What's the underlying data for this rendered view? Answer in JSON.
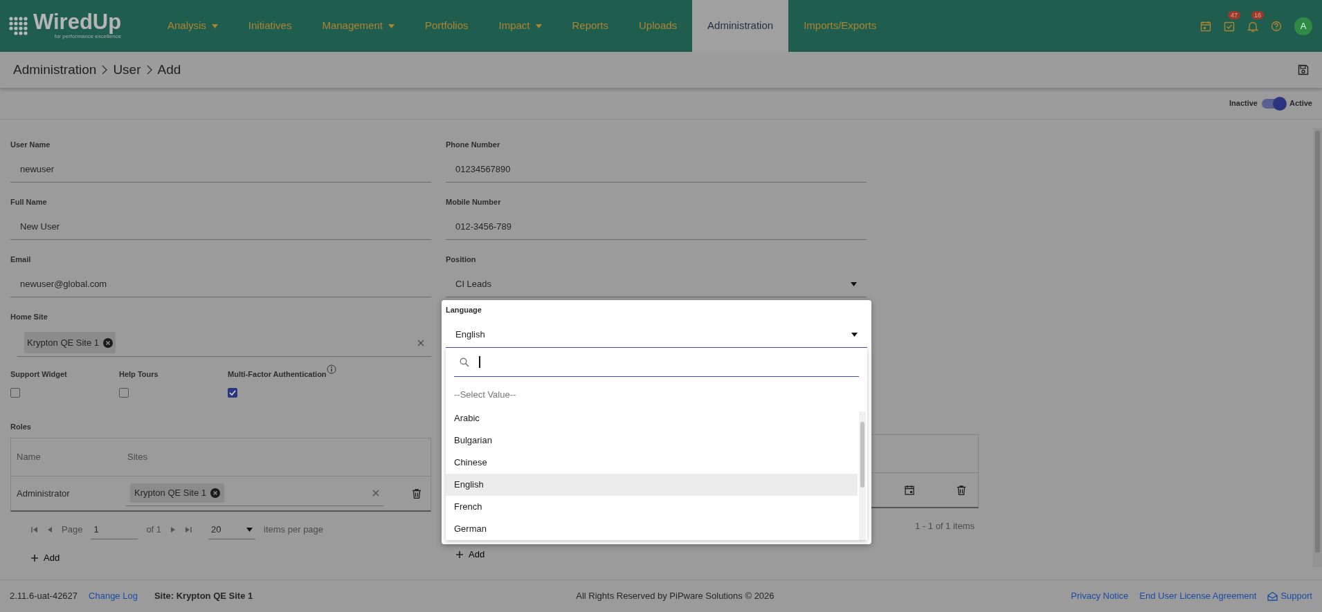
{
  "nav": {
    "logo": {
      "title": "WiredUp",
      "tagline": "for performance excellence"
    },
    "items": [
      {
        "label": "Analysis",
        "has_menu": true,
        "selected": false
      },
      {
        "label": "Initiatives",
        "has_menu": false,
        "selected": false
      },
      {
        "label": "Management",
        "has_menu": true,
        "selected": false
      },
      {
        "label": "Portfolios",
        "has_menu": false,
        "selected": false
      },
      {
        "label": "Impact",
        "has_menu": true,
        "selected": false
      },
      {
        "label": "Reports",
        "has_menu": false,
        "selected": false
      },
      {
        "label": "Uploads",
        "has_menu": false,
        "selected": false
      },
      {
        "label": "Administration",
        "has_menu": false,
        "selected": true
      },
      {
        "label": "Imports/Exports",
        "has_menu": false,
        "selected": false
      }
    ],
    "icons": [
      {
        "kind": "calendar"
      },
      {
        "kind": "tasks",
        "badge": "47"
      },
      {
        "kind": "bell",
        "badge": "16"
      },
      {
        "kind": "help"
      }
    ],
    "avatar": "A"
  },
  "breadcrumb": [
    "Administration",
    "User",
    "Add"
  ],
  "status_toggle": {
    "off_label": "Inactive",
    "on_label": "Active",
    "on": true
  },
  "left_fields": [
    {
      "label": "User Name",
      "value": "newuser",
      "kind": "text"
    },
    {
      "label": "Full Name",
      "value": "New User",
      "kind": "text"
    },
    {
      "label": "Email",
      "value": "newuser@global.com",
      "kind": "text"
    },
    {
      "label": "Home Site",
      "chips": [
        "Krypton QE Site 1"
      ],
      "kind": "chips"
    }
  ],
  "right_fields": [
    {
      "label": "Phone Number",
      "value": "01234567890",
      "kind": "text"
    },
    {
      "label": "Mobile Number",
      "value": "012-3456-789",
      "kind": "text"
    },
    {
      "label": "Position",
      "value": "CI Leads",
      "kind": "select"
    }
  ],
  "language": {
    "label": "Language",
    "value": "English",
    "expanded": true,
    "prompt": "--Select Value--",
    "options": [
      {
        "label": "Arabic",
        "selected": false
      },
      {
        "label": "Bulgarian",
        "selected": false
      },
      {
        "label": "Chinese",
        "selected": false
      },
      {
        "label": "English",
        "selected": true
      },
      {
        "label": "French",
        "selected": false
      },
      {
        "label": "German",
        "selected": false
      }
    ]
  },
  "flags": [
    {
      "label": "Support Widget",
      "checked": false,
      "has_info": false
    },
    {
      "label": "Help Tours",
      "checked": false,
      "has_info": false
    },
    {
      "label": "Multi-Factor Authentication",
      "checked": true,
      "has_info": true
    }
  ],
  "roles": {
    "label": "Roles",
    "columns": [
      "Name",
      "Sites"
    ],
    "rows": [
      {
        "name": "Administrator",
        "sites": [
          "Krypton QE Site 1"
        ]
      }
    ],
    "pager": {
      "page_label": "Page",
      "page": "1",
      "of": "of 1",
      "page_size": "20",
      "per_page": "items per page"
    },
    "add": "Add"
  },
  "second_table": {
    "summary": "1 - 1 of 1 items",
    "add": "Add"
  },
  "footer": {
    "version": "2.11.6-uat-42627",
    "change_log": "Change Log",
    "site": "Site: Krypton QE Site 1",
    "copyright": "All Rights Reserved by PiPware Solutions © 2026",
    "links": [
      "Privacy Notice",
      "End User License Agreement"
    ],
    "support": "Support"
  }
}
